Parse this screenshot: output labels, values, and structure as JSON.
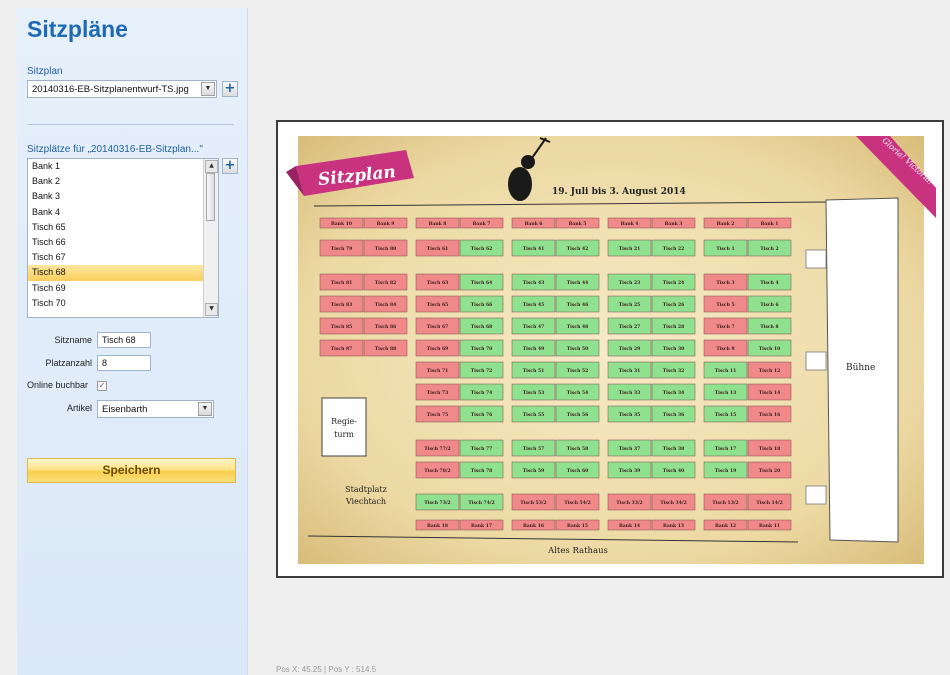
{
  "sidebar": {
    "title": "Sitzpläne",
    "plan_label": "Sitzplan",
    "plan_select": "20140316-EB-Sitzplanentwurf-TS.jpg",
    "add_label": "+",
    "seats_label": "Sitzplätze für „20140316-EB-Sitzplan...\"",
    "seats": [
      "Bank 1",
      "Bank 2",
      "Bank 3",
      "Bank 4",
      "Tisch 65",
      "Tisch 66",
      "Tisch 67",
      "Tisch 68",
      "Tisch 69",
      "Tisch 70"
    ],
    "selected_index": 7,
    "form": {
      "name_label": "Sitzname",
      "name_value": "Tisch 68",
      "count_label": "Platzanzahl",
      "count_value": "8",
      "online_label": "Online buchbar",
      "online_checked": true,
      "article_label": "Artikel",
      "article_value": "Eisenbarth"
    },
    "save_label": "Speichern"
  },
  "plan": {
    "banner_left": "Sitzplan",
    "date_text": "19. Juli bis 3. August 2014",
    "banner_right": "Gloria! Victoria!",
    "stage_label": "Bühne",
    "regie_label_1": "Regie-",
    "regie_label_2": "turm",
    "stadt_label_1": "Stadtplatz",
    "stadt_label_2": "Viechtach",
    "rathaus_label": "Altes Rathaus",
    "colors": {
      "free": "#8fe08f",
      "taken": "#f08a8a",
      "paper": "#efe1b4",
      "ribbon": "#c8327f"
    },
    "block_columns": [
      {
        "rows": [
          [
            {
              "t": "Bank 10",
              "s": "taken"
            },
            {
              "t": "Bank 9",
              "s": "taken"
            }
          ],
          [
            {
              "t": "Tisch 79",
              "s": "taken"
            },
            {
              "t": "Tisch 80",
              "s": "taken"
            }
          ],
          [
            {
              "t": "Tisch 81",
              "s": "taken"
            },
            {
              "t": "Tisch 82",
              "s": "taken"
            }
          ],
          [
            {
              "t": "Tisch 83",
              "s": "taken"
            },
            {
              "t": "Tisch 84",
              "s": "taken"
            }
          ],
          [
            {
              "t": "Tisch 85",
              "s": "taken"
            },
            {
              "t": "Tisch 86",
              "s": "taken"
            }
          ],
          [
            {
              "t": "Tisch 87",
              "s": "taken"
            },
            {
              "t": "Tisch 88",
              "s": "taken"
            }
          ]
        ]
      },
      {
        "rows": [
          [
            {
              "t": "Bank 8",
              "s": "taken"
            },
            {
              "t": "Bank 7",
              "s": "taken"
            }
          ],
          [
            {
              "t": "Tisch 61",
              "s": "taken"
            },
            {
              "t": "Tisch 62",
              "s": "free"
            }
          ],
          [
            {
              "t": "Tisch 63",
              "s": "taken"
            },
            {
              "t": "Tisch 64",
              "s": "free"
            }
          ],
          [
            {
              "t": "Tisch 65",
              "s": "taken"
            },
            {
              "t": "Tisch 66",
              "s": "free"
            }
          ],
          [
            {
              "t": "Tisch 67",
              "s": "taken"
            },
            {
              "t": "Tisch 68",
              "s": "free"
            }
          ],
          [
            {
              "t": "Tisch 69",
              "s": "taken"
            },
            {
              "t": "Tisch 70",
              "s": "free"
            }
          ],
          [
            {
              "t": "Tisch 71",
              "s": "taken"
            },
            {
              "t": "Tisch 72",
              "s": "free"
            }
          ],
          [
            {
              "t": "Tisch 73",
              "s": "taken"
            },
            {
              "t": "Tisch 74",
              "s": "free"
            }
          ],
          [
            {
              "t": "Tisch 75",
              "s": "taken"
            },
            {
              "t": "Tisch 76",
              "s": "free"
            }
          ],
          [
            {
              "t": "Tisch 77/2",
              "s": "taken"
            },
            {
              "t": "Tisch 77",
              "s": "free"
            }
          ],
          [
            {
              "t": "Tisch 78/2",
              "s": "taken"
            },
            {
              "t": "Tisch 78",
              "s": "free"
            }
          ],
          [
            {
              "t": "Tisch 73/2",
              "s": "free"
            },
            {
              "t": "Tisch 74/2",
              "s": "free"
            }
          ],
          [
            {
              "t": "Bank 18",
              "s": "taken"
            },
            {
              "t": "Bank 17",
              "s": "taken"
            }
          ]
        ]
      },
      {
        "rows": [
          [
            {
              "t": "Bank 6",
              "s": "taken"
            },
            {
              "t": "Bank 5",
              "s": "taken"
            }
          ],
          [
            {
              "t": "Tisch 41",
              "s": "free"
            },
            {
              "t": "Tisch 42",
              "s": "free"
            }
          ],
          [
            {
              "t": "Tisch 43",
              "s": "free"
            },
            {
              "t": "Tisch 44",
              "s": "free"
            }
          ],
          [
            {
              "t": "Tisch 45",
              "s": "free"
            },
            {
              "t": "Tisch 46",
              "s": "free"
            }
          ],
          [
            {
              "t": "Tisch 47",
              "s": "free"
            },
            {
              "t": "Tisch 48",
              "s": "free"
            }
          ],
          [
            {
              "t": "Tisch 49",
              "s": "free"
            },
            {
              "t": "Tisch 50",
              "s": "free"
            }
          ],
          [
            {
              "t": "Tisch 51",
              "s": "free"
            },
            {
              "t": "Tisch 52",
              "s": "free"
            }
          ],
          [
            {
              "t": "Tisch 53",
              "s": "free"
            },
            {
              "t": "Tisch 54",
              "s": "free"
            }
          ],
          [
            {
              "t": "Tisch 55",
              "s": "free"
            },
            {
              "t": "Tisch 56",
              "s": "free"
            }
          ],
          [
            {
              "t": "Tisch 57",
              "s": "free"
            },
            {
              "t": "Tisch 58",
              "s": "free"
            }
          ],
          [
            {
              "t": "Tisch 59",
              "s": "free"
            },
            {
              "t": "Tisch 60",
              "s": "free"
            }
          ],
          [
            {
              "t": "Tisch 53/2",
              "s": "taken"
            },
            {
              "t": "Tisch 54/2",
              "s": "taken"
            }
          ],
          [
            {
              "t": "Bank 16",
              "s": "taken"
            },
            {
              "t": "Bank 15",
              "s": "taken"
            }
          ]
        ]
      },
      {
        "rows": [
          [
            {
              "t": "Bank 4",
              "s": "taken"
            },
            {
              "t": "Bank 3",
              "s": "taken"
            }
          ],
          [
            {
              "t": "Tisch 21",
              "s": "free"
            },
            {
              "t": "Tisch 22",
              "s": "free"
            }
          ],
          [
            {
              "t": "Tisch 23",
              "s": "free"
            },
            {
              "t": "Tisch 24",
              "s": "free"
            }
          ],
          [
            {
              "t": "Tisch 25",
              "s": "free"
            },
            {
              "t": "Tisch 26",
              "s": "free"
            }
          ],
          [
            {
              "t": "Tisch 27",
              "s": "free"
            },
            {
              "t": "Tisch 28",
              "s": "free"
            }
          ],
          [
            {
              "t": "Tisch 29",
              "s": "free"
            },
            {
              "t": "Tisch 30",
              "s": "free"
            }
          ],
          [
            {
              "t": "Tisch 31",
              "s": "free"
            },
            {
              "t": "Tisch 32",
              "s": "free"
            }
          ],
          [
            {
              "t": "Tisch 33",
              "s": "free"
            },
            {
              "t": "Tisch 34",
              "s": "free"
            }
          ],
          [
            {
              "t": "Tisch 35",
              "s": "free"
            },
            {
              "t": "Tisch 36",
              "s": "free"
            }
          ],
          [
            {
              "t": "Tisch 37",
              "s": "free"
            },
            {
              "t": "Tisch 38",
              "s": "free"
            }
          ],
          [
            {
              "t": "Tisch 39",
              "s": "free"
            },
            {
              "t": "Tisch 40",
              "s": "free"
            }
          ],
          [
            {
              "t": "Tisch 33/2",
              "s": "taken"
            },
            {
              "t": "Tisch 34/2",
              "s": "taken"
            }
          ],
          [
            {
              "t": "Bank 14",
              "s": "taken"
            },
            {
              "t": "Bank 13",
              "s": "taken"
            }
          ]
        ]
      },
      {
        "rows": [
          [
            {
              "t": "Bank 2",
              "s": "taken"
            },
            {
              "t": "Bank 1",
              "s": "taken"
            }
          ],
          [
            {
              "t": "Tisch 1",
              "s": "free"
            },
            {
              "t": "Tisch 2",
              "s": "free"
            }
          ],
          [
            {
              "t": "Tisch 3",
              "s": "taken"
            },
            {
              "t": "Tisch 4",
              "s": "free"
            }
          ],
          [
            {
              "t": "Tisch 5",
              "s": "taken"
            },
            {
              "t": "Tisch 6",
              "s": "free"
            }
          ],
          [
            {
              "t": "Tisch 7",
              "s": "taken"
            },
            {
              "t": "Tisch 8",
              "s": "free"
            }
          ],
          [
            {
              "t": "Tisch 9",
              "s": "taken"
            },
            {
              "t": "Tisch 10",
              "s": "free"
            }
          ],
          [
            {
              "t": "Tisch 11",
              "s": "free"
            },
            {
              "t": "Tisch 12",
              "s": "taken"
            }
          ],
          [
            {
              "t": "Tisch 13",
              "s": "free"
            },
            {
              "t": "Tisch 14",
              "s": "taken"
            }
          ],
          [
            {
              "t": "Tisch 15",
              "s": "free"
            },
            {
              "t": "Tisch 16",
              "s": "taken"
            }
          ],
          [
            {
              "t": "Tisch 17",
              "s": "free"
            },
            {
              "t": "Tisch 18",
              "s": "taken"
            }
          ],
          [
            {
              "t": "Tisch 19",
              "s": "free"
            },
            {
              "t": "Tisch 20",
              "s": "taken"
            }
          ],
          [
            {
              "t": "Tisch 13/2",
              "s": "taken"
            },
            {
              "t": "Tisch 14/2",
              "s": "taken"
            }
          ],
          [
            {
              "t": "Bank 12",
              "s": "taken"
            },
            {
              "t": "Bank 11",
              "s": "taken"
            }
          ]
        ]
      }
    ]
  },
  "status": {
    "pos_text": "Pos X: 45.25 | Pos Y : 514.5"
  }
}
